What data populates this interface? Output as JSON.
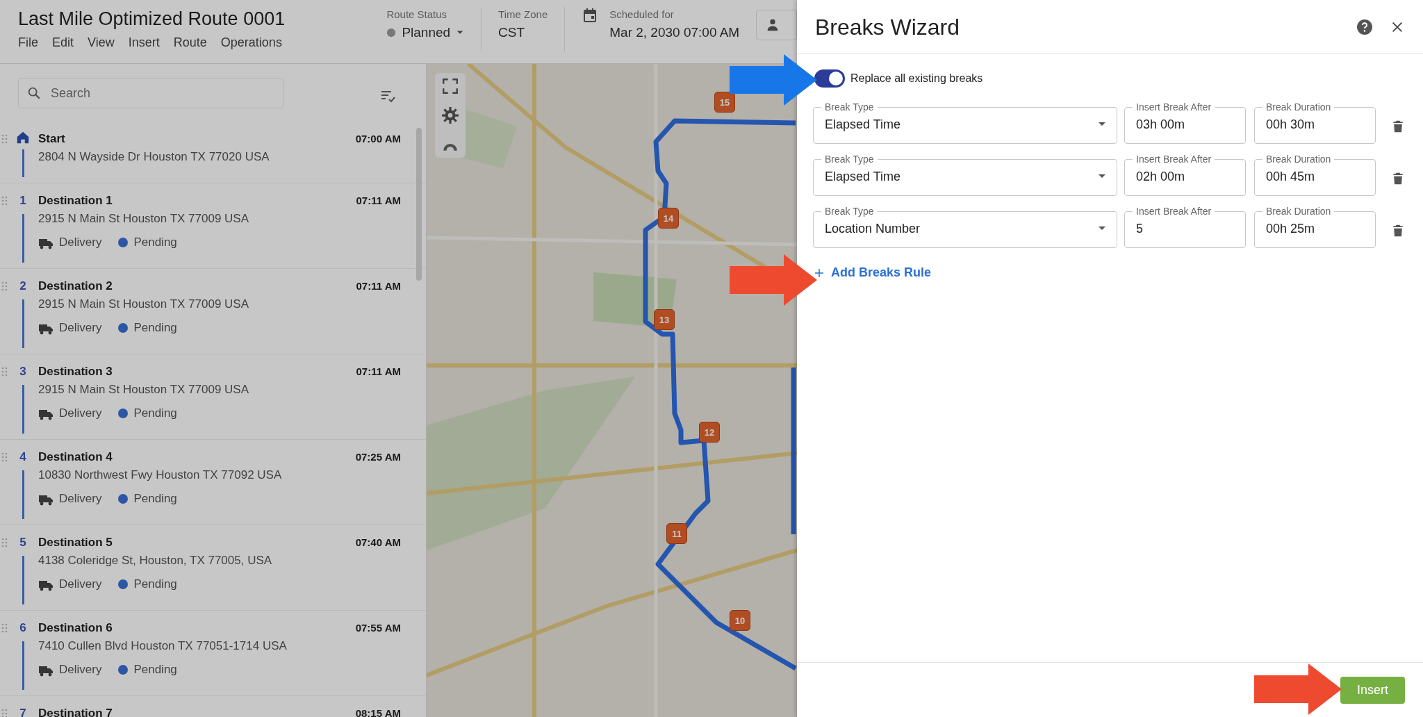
{
  "app": {
    "title": "Last Mile Optimized Route 0001",
    "menu": [
      "File",
      "Edit",
      "View",
      "Insert",
      "Route",
      "Operations"
    ],
    "route_status": {
      "label": "Route Status",
      "value": "Planned"
    },
    "time_zone": {
      "label": "Time Zone",
      "value": "CST"
    },
    "scheduled": {
      "label": "Scheduled for",
      "value": "Mar 2, 2030 07:00 AM"
    }
  },
  "sidebar": {
    "search": {
      "placeholder": "Search"
    },
    "stops": [
      {
        "kind": "start",
        "name": "Start",
        "time": "07:00 AM",
        "address": "2804 N Wayside Dr Houston TX 77020 USA"
      },
      {
        "kind": "destination",
        "number": "1",
        "name": "Destination 1",
        "time": "07:11 AM",
        "address": "2915 N Main St Houston TX 77009 USA",
        "type": "Delivery",
        "status": "Pending"
      },
      {
        "kind": "destination",
        "number": "2",
        "name": "Destination 2",
        "time": "07:11 AM",
        "address": "2915 N Main St Houston TX 77009 USA",
        "type": "Delivery",
        "status": "Pending"
      },
      {
        "kind": "destination",
        "number": "3",
        "name": "Destination 3",
        "time": "07:11 AM",
        "address": "2915 N Main St Houston TX 77009 USA",
        "type": "Delivery",
        "status": "Pending"
      },
      {
        "kind": "destination",
        "number": "4",
        "name": "Destination 4",
        "time": "07:25 AM",
        "address": "10830 Northwest Fwy Houston TX 77092 USA",
        "type": "Delivery",
        "status": "Pending"
      },
      {
        "kind": "destination",
        "number": "5",
        "name": "Destination 5",
        "time": "07:40 AM",
        "address": "4138 Coleridge St, Houston, TX 77005, USA",
        "type": "Delivery",
        "status": "Pending"
      },
      {
        "kind": "destination",
        "number": "6",
        "name": "Destination 6",
        "time": "07:55 AM",
        "address": "7410 Cullen Blvd Houston TX 77051-1714 USA",
        "type": "Delivery",
        "status": "Pending"
      },
      {
        "kind": "destination",
        "number": "7",
        "name": "Destination 7",
        "time": "08:15 AM"
      }
    ]
  },
  "map": {
    "markers": [
      {
        "label": "15"
      },
      {
        "label": "14"
      },
      {
        "label": "13"
      },
      {
        "label": "12"
      },
      {
        "label": "11"
      },
      {
        "label": "10"
      }
    ]
  },
  "dialog": {
    "title": "Breaks Wizard",
    "replace_all": {
      "label": "Replace all existing breaks",
      "on": true
    },
    "rules": [
      {
        "type_label": "Break Type",
        "type": "Elapsed Time",
        "after_label": "Insert Break After",
        "after": "03h 00m",
        "duration_label": "Break Duration",
        "duration": "00h 30m"
      },
      {
        "type_label": "Break Type",
        "type": "Elapsed Time",
        "after_label": "Insert Break After",
        "after": "02h 00m",
        "duration_label": "Break Duration",
        "duration": "00h 45m"
      },
      {
        "type_label": "Break Type",
        "type": "Location Number",
        "after_label": "Insert Break After",
        "after": "5",
        "duration_label": "Break Duration",
        "duration": "00h 25m"
      }
    ],
    "add_rule": "Add Breaks Rule",
    "insert_button": "Insert"
  },
  "callouts": [
    {
      "color": "#1877e8"
    },
    {
      "color": "#ee4a2f"
    },
    {
      "color": "#ee4a2f"
    }
  ]
}
